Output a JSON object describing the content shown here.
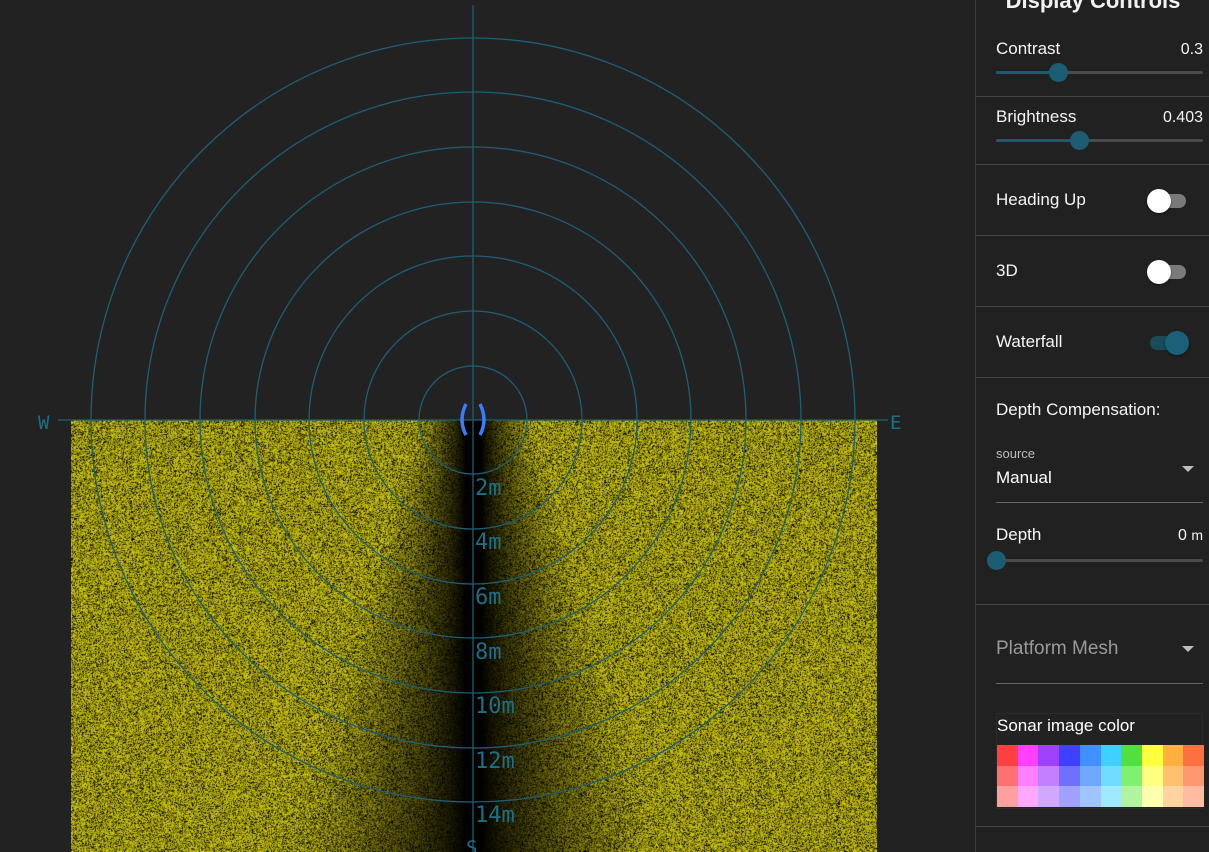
{
  "sonar": {
    "compass": {
      "west": "W",
      "east": "E",
      "south": "S"
    },
    "range_labels": [
      "2m",
      "4m",
      "6m",
      "8m",
      "10m",
      "12m",
      "14m"
    ],
    "grid_color": "#1d5f75",
    "waterfall_color": "#c8c20a",
    "marker_color": "#3a7bff"
  },
  "panel": {
    "title": "Display Controls",
    "contrast": {
      "label": "Contrast",
      "value": "0.3",
      "level": 0.3
    },
    "brightness": {
      "label": "Brightness",
      "value": "0.403",
      "level": 0.403
    },
    "heading_up": {
      "label": "Heading Up",
      "on": false
    },
    "three_d": {
      "label": "3D",
      "on": false
    },
    "waterfall": {
      "label": "Waterfall",
      "on": true
    },
    "depth_comp": {
      "label": "Depth Compensation:",
      "source_label": "source",
      "source_value": "Manual",
      "depth_label": "Depth",
      "depth_value": "0",
      "depth_unit": "m",
      "depth_level": 0
    },
    "platform_mesh": {
      "label": "Platform Mesh"
    },
    "sonar_color": {
      "label": "Sonar image color",
      "swatches": [
        "#ff4040",
        "#ff40ff",
        "#a040ff",
        "#4040ff",
        "#4090ff",
        "#40d0ff",
        "#50e040",
        "#ffff40",
        "#ffb040",
        "#ff7040",
        "#ff7070",
        "#ff80ff",
        "#c080ff",
        "#7070ff",
        "#70a8ff",
        "#70dcff",
        "#80f070",
        "#ffff80",
        "#ffc070",
        "#ff9870",
        "#ffa0a0",
        "#ffa8ff",
        "#d0a8ff",
        "#a0a0ff",
        "#a0c4ff",
        "#a0e8ff",
        "#b0f4a0",
        "#ffffb0",
        "#ffd4a0",
        "#ffbca0"
      ]
    }
  }
}
